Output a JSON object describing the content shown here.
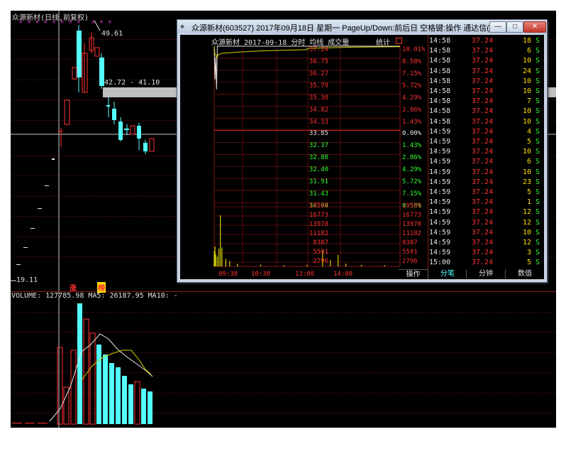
{
  "main": {
    "title": "众源新材(日线,前复权)",
    "x_marks_top": "× × × ×  × × × ×",
    "x_marks_top2": "× × ×",
    "high_label": "49.61",
    "range_label": "42.72 - 41.10",
    "low_label": "19.11",
    "volume_title": "VOLUME: 127785.98 MA5: 26187.95 MA10: -",
    "badge_up": "涨",
    "badge_hot": "榜"
  },
  "colors": {
    "up": "#ff3232",
    "down": "#54ffff",
    "ma_white": "#e6e6e6",
    "ma_yellow": "#d2d200"
  },
  "popup": {
    "title": "众源新材(603527) 2017年09月18日 星期一 PageUp/Down:前后日 空格键:操作 通达信(R)",
    "btn_min": "—",
    "btn_max": "□",
    "btn_close": "✕",
    "chart_header": "众源新材  2017-09-18 分时 均线 成交量",
    "chart_header_right": "统计",
    "price_ticks_left": [
      "37.24",
      "36.75",
      "36.27",
      "35.79",
      "35.30",
      "34.82",
      "34.33",
      "33.85",
      "32.37",
      "32.88",
      "32.40",
      "31.91",
      "31.43",
      "30.94"
    ],
    "pct_ticks_right": [
      "10.01%",
      "8.58%",
      "7.15%",
      "5.72%",
      "4.29%",
      "2.86%",
      "1.43%",
      "0.00%",
      "1.43%",
      "2.86%",
      "4.29%",
      "5.72%",
      "7.15%",
      "8.58%"
    ],
    "vol_ticks": [
      "19569",
      "16773",
      "13978",
      "11182",
      "8387",
      "5591",
      "2796"
    ],
    "time_ticks": [
      "09:30",
      "10:30",
      "13:00",
      "14:00"
    ],
    "chart_data": {
      "type": "line",
      "title": "众源新材  2017-09-18 分时 均线 成交量",
      "xlabel": "",
      "ylabel": "",
      "x": [
        "09:30",
        "09:31",
        "09:32",
        "09:33",
        "09:34",
        "09:35",
        "09:40",
        "10:00",
        "10:30",
        "11:30",
        "13:00",
        "14:00",
        "15:00"
      ],
      "series": [
        {
          "values": [
            37.24,
            35.9,
            36.8,
            35.5,
            37.24,
            37.24,
            37.24,
            37.24,
            37.24,
            37.24,
            37.24,
            37.24,
            37.24
          ]
        },
        {
          "values": [
            37.24,
            36.9,
            36.9,
            36.8,
            36.8,
            36.9,
            36.95,
            37.0,
            37.05,
            37.1,
            37.15,
            37.2,
            37.22
          ]
        }
      ],
      "ylim": [
        30.94,
        37.24
      ],
      "volume": [
        {
          "t": "09:30",
          "v": 5000
        },
        {
          "t": "09:31",
          "v": 6500
        },
        {
          "t": "09:32",
          "v": 4000
        },
        {
          "t": "09:34",
          "v": 3200
        },
        {
          "t": "09:36",
          "v": 5800
        },
        {
          "t": "09:38",
          "v": 16800
        },
        {
          "t": "09:40",
          "v": 6200
        },
        {
          "t": "09:45",
          "v": 2500
        },
        {
          "t": "09:50",
          "v": 1800
        },
        {
          "t": "10:00",
          "v": 900
        },
        {
          "t": "10:30",
          "v": 600
        },
        {
          "t": "11:00",
          "v": 400
        },
        {
          "t": "13:00",
          "v": 500
        },
        {
          "t": "13:20",
          "v": 5200
        },
        {
          "t": "13:30",
          "v": 2100
        },
        {
          "t": "13:40",
          "v": 3800
        },
        {
          "t": "13:50",
          "v": 900
        },
        {
          "t": "14:10",
          "v": 500
        },
        {
          "t": "14:40",
          "v": 400
        }
      ],
      "vol_ylim": [
        0,
        19569
      ]
    },
    "ticks_table": [
      {
        "time": "14:58",
        "price": "37.24",
        "vol": "18",
        "flag": "S"
      },
      {
        "time": "14:58",
        "price": "37.24",
        "vol": "6",
        "flag": "S"
      },
      {
        "time": "14:58",
        "price": "37.24",
        "vol": "10",
        "flag": "S"
      },
      {
        "time": "14:58",
        "price": "37.24",
        "vol": "24",
        "flag": "S"
      },
      {
        "time": "14:58",
        "price": "37.24",
        "vol": "10",
        "flag": "S"
      },
      {
        "time": "14:58",
        "price": "37.24",
        "vol": "10",
        "flag": "S"
      },
      {
        "time": "14:58",
        "price": "37.24",
        "vol": "7",
        "flag": "S"
      },
      {
        "time": "14:58",
        "price": "37.24",
        "vol": "10",
        "flag": "S"
      },
      {
        "time": "14:58",
        "price": "37.24",
        "vol": "10",
        "flag": "S"
      },
      {
        "time": "14:59",
        "price": "37.24",
        "vol": "4",
        "flag": "S"
      },
      {
        "time": "14:59",
        "price": "37.24",
        "vol": "5",
        "flag": "S"
      },
      {
        "time": "14:59",
        "price": "37.24",
        "vol": "10",
        "flag": "S"
      },
      {
        "time": "14:59",
        "price": "37.24",
        "vol": "6",
        "flag": "S"
      },
      {
        "time": "14:59",
        "price": "37.24",
        "vol": "10",
        "flag": "S"
      },
      {
        "time": "14:59",
        "price": "37.24",
        "vol": "23",
        "flag": "S"
      },
      {
        "time": "14:59",
        "price": "37.24",
        "vol": "5",
        "flag": "S"
      },
      {
        "time": "14:59",
        "price": "37.24",
        "vol": "1",
        "flag": "S"
      },
      {
        "time": "14:59",
        "price": "37.24",
        "vol": "12",
        "flag": "S"
      },
      {
        "time": "14:59",
        "price": "37.24",
        "vol": "12",
        "flag": "S"
      },
      {
        "time": "14:59",
        "price": "37.24",
        "vol": "10",
        "flag": "S"
      },
      {
        "time": "14:59",
        "price": "37.24",
        "vol": "12",
        "flag": "S"
      },
      {
        "time": "14:59",
        "price": "37.24",
        "vol": "3",
        "flag": "S"
      },
      {
        "time": "15:00",
        "price": "37.24",
        "vol": "5",
        "flag": "S"
      }
    ],
    "tabs": [
      "操作",
      "分笔",
      "分钟",
      "数值"
    ]
  }
}
